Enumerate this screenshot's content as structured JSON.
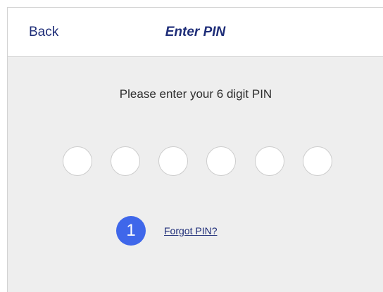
{
  "header": {
    "back_label": "Back",
    "title": "Enter PIN"
  },
  "main": {
    "prompt": "Please enter your 6 digit PIN",
    "pin_length": 6,
    "pin_filled": 0,
    "step_badge": "1",
    "forgot_link": "Forgot PIN?"
  },
  "colors": {
    "header_text": "#1e2d78",
    "badge_background": "#3f67ea",
    "content_background": "#eeeeee"
  }
}
